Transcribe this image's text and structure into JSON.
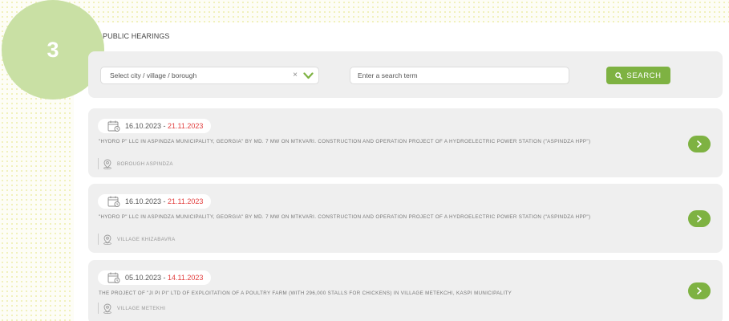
{
  "step_number": "3",
  "page_title": "PUBLIC HEARINGS",
  "filters": {
    "select_placeholder": "Select city / village / borough",
    "clear_symbol": "×",
    "search_placeholder": "Enter a search term",
    "search_button": "SEARCH"
  },
  "colors": {
    "accent_green": "#7eb242",
    "step_circle": "#c9e0a4",
    "end_date_red": "#e24040"
  },
  "icons": {
    "calendar": "calendar-icon",
    "location": "location-pin-icon",
    "arrow": "chevron-right-icon",
    "search": "search-icon",
    "dropdown": "chevron-down-icon"
  },
  "hearings": [
    {
      "start_date": "16.10.2023",
      "end_date": "21.11.2023",
      "description": "\"Hydro P\" LLC in Aspindza Municipality, Georgia\" by Md. 7 MW on Mtkvari. Construction and operation project of a hydroelectric power station (\"Aspindza HPP\")",
      "location": "BOROUGH ASPINDZA"
    },
    {
      "start_date": "16.10.2023",
      "end_date": "21.11.2023",
      "description": "\"Hydro P\" LLC in Aspindza Municipality, Georgia\" by Md. 7 MW on Mtkvari. Construction and operation project of a hydroelectric power station (\"Aspindza HPP\")",
      "location": "VILLAGE KHIZABAVRA"
    },
    {
      "start_date": "05.10.2023",
      "end_date": "14.11.2023",
      "description": "The project of \"Ji Pi Pi\" LTD of exploitation of a poultry farm (with 296,000 stalls for chickens) in village Metekchi, Kaspi municipality",
      "location": "VILLAGE METEKHI"
    }
  ]
}
